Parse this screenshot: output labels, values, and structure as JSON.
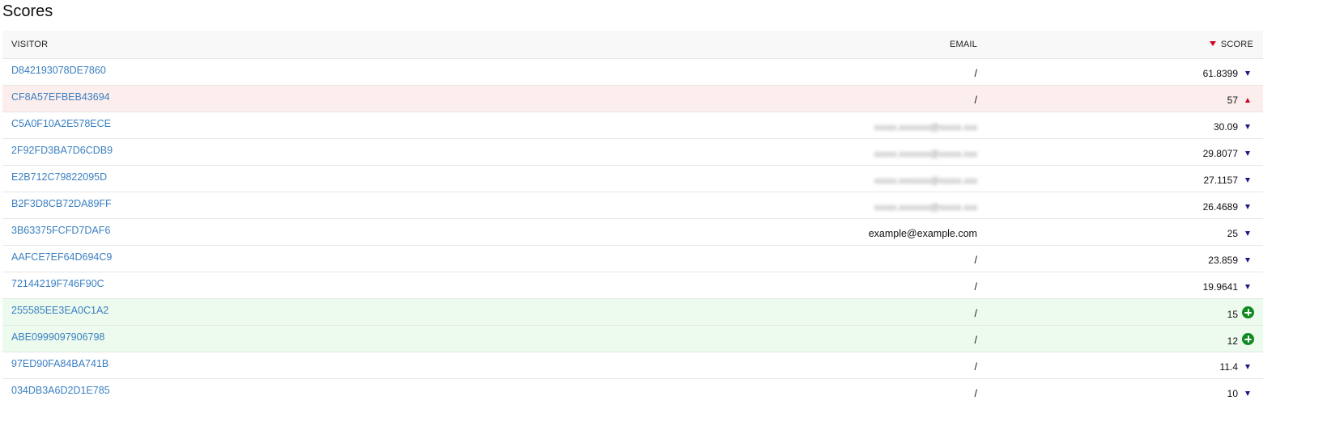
{
  "page": {
    "title": "Scores"
  },
  "table": {
    "headers": {
      "visitor": "VISITOR",
      "email": "EMAIL",
      "score": "SCORE"
    },
    "sort": {
      "column": "score",
      "direction": "desc"
    },
    "rows": [
      {
        "visitor": "D842193078DE7860",
        "email": "/",
        "email_blurred": false,
        "score": "61.8399",
        "trend": "down",
        "highlight": "none"
      },
      {
        "visitor": "CF8A57EFBEB43694",
        "email": "/",
        "email_blurred": false,
        "score": "57",
        "trend": "up",
        "highlight": "up"
      },
      {
        "visitor": "C5A0F10A2E578ECE",
        "email": "",
        "email_blurred": true,
        "score": "30.09",
        "trend": "down",
        "highlight": "none"
      },
      {
        "visitor": "2F92FD3BA7D6CDB9",
        "email": "",
        "email_blurred": true,
        "score": "29.8077",
        "trend": "down",
        "highlight": "none"
      },
      {
        "visitor": "E2B712C79822095D",
        "email": "",
        "email_blurred": true,
        "score": "27.1157",
        "trend": "down",
        "highlight": "none"
      },
      {
        "visitor": "B2F3D8CB72DA89FF",
        "email": "",
        "email_blurred": true,
        "score": "26.4689",
        "trend": "down",
        "highlight": "none"
      },
      {
        "visitor": "3B63375FCFD7DAF6",
        "email": "example@example.com",
        "email_blurred": false,
        "score": "25",
        "trend": "down",
        "highlight": "none"
      },
      {
        "visitor": "AAFCE7EF64D694C9",
        "email": "/",
        "email_blurred": false,
        "score": "23.859",
        "trend": "down",
        "highlight": "none"
      },
      {
        "visitor": "72144219F746F90C",
        "email": "/",
        "email_blurred": false,
        "score": "19.9641",
        "trend": "down",
        "highlight": "none"
      },
      {
        "visitor": "255585EE3EA0C1A2",
        "email": "/",
        "email_blurred": false,
        "score": "15",
        "trend": "new",
        "highlight": "new"
      },
      {
        "visitor": "ABE0999097906798",
        "email": "/",
        "email_blurred": false,
        "score": "12",
        "trend": "new",
        "highlight": "new"
      },
      {
        "visitor": "97ED90FA84BA741B",
        "email": "/",
        "email_blurred": false,
        "score": "11.4",
        "trend": "down",
        "highlight": "none"
      },
      {
        "visitor": "034DB3A6D2D1E785",
        "email": "/",
        "email_blurred": false,
        "score": "10",
        "trend": "down",
        "highlight": "none"
      }
    ]
  },
  "colors": {
    "link": "#3a7fc1",
    "row_up_bg": "#fdeeee",
    "row_new_bg": "#edfbee",
    "trend_down": "#1a1a8c",
    "trend_up": "#d0021b",
    "trend_new": "#0f8a1f",
    "sort_caret": "#d0021b"
  }
}
